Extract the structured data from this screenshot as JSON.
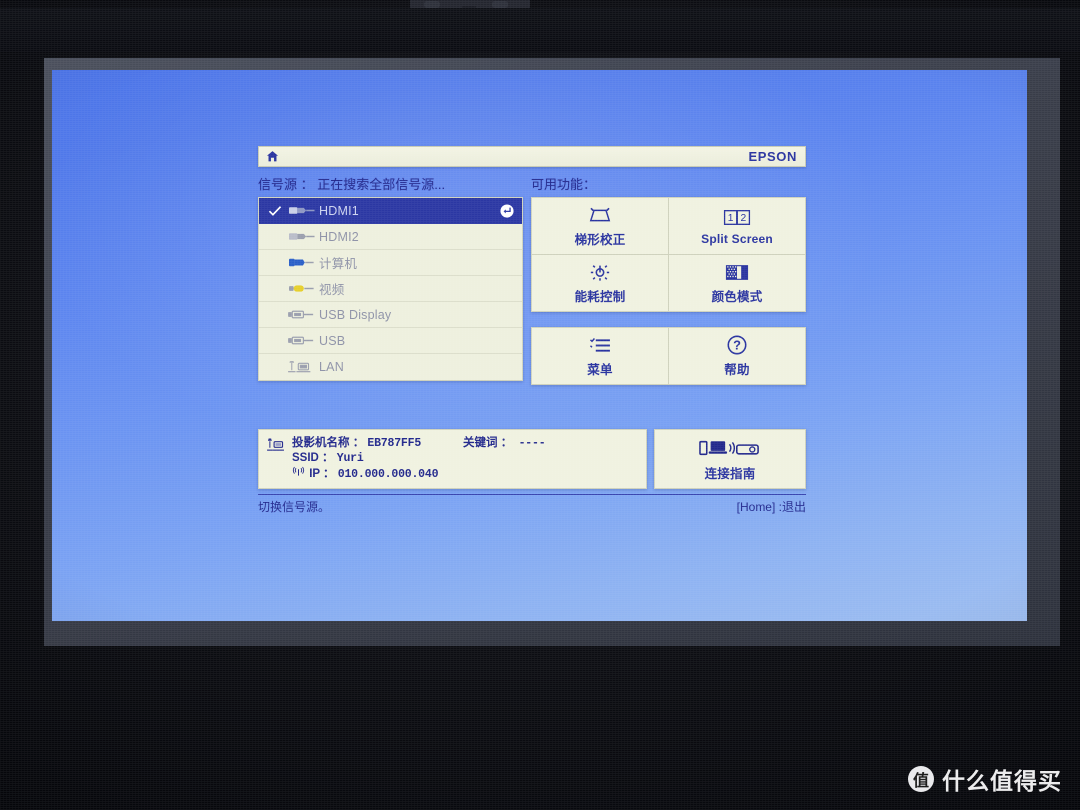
{
  "header": {
    "home_icon": "home-icon",
    "brand": "EPSON"
  },
  "labels": {
    "source_label": "信号源 ： 正在搜索全部信号源...",
    "functions_label": "可用功能："
  },
  "sources": [
    {
      "name": "HDMI1",
      "icon": "hdmi-connector-icon",
      "selected": true,
      "enter_icon": "enter-key-icon"
    },
    {
      "name": "HDMI2",
      "icon": "hdmi-connector-icon",
      "selected": false
    },
    {
      "name": "计算机",
      "icon": "vga-connector-icon",
      "selected": false
    },
    {
      "name": "视频",
      "icon": "composite-video-icon",
      "selected": false
    },
    {
      "name": "USB Display",
      "icon": "usb-connector-icon",
      "selected": false
    },
    {
      "name": "USB",
      "icon": "usb-connector-icon",
      "selected": false
    },
    {
      "name": "LAN",
      "icon": "lan-network-icon",
      "selected": false
    }
  ],
  "functions_top": [
    {
      "label": "梯形校正",
      "icon": "keystone-icon",
      "latin": false
    },
    {
      "label": "Split Screen",
      "icon": "split-screen-icon",
      "latin": true
    },
    {
      "label": "能耗控制",
      "icon": "power-consumption-icon",
      "latin": false
    },
    {
      "label": "颜色模式",
      "icon": "color-mode-icon",
      "latin": false
    }
  ],
  "functions_bottom": [
    {
      "label": "菜单",
      "icon": "menu-list-icon",
      "latin": false
    },
    {
      "label": "帮助",
      "icon": "help-question-icon",
      "latin": false
    }
  ],
  "info": {
    "lan_icon": "lan-network-icon",
    "projector_name_key": "投影机名称 ：",
    "projector_name_value": "EB787FF5",
    "keyword_key": "关键词 ：",
    "keyword_value": "----",
    "ssid_key": "SSID ：",
    "ssid_value": "Yuri",
    "ip_key": "IP ：",
    "ip_value": "010.000.000.040",
    "wifi_icon": "wifi-signal-icon"
  },
  "connect_guide": {
    "label": "连接指南",
    "icon": "connect-guide-icon"
  },
  "footer": {
    "hint": "切换信号源。",
    "exit": "[Home] :退出"
  },
  "watermark": {
    "logo_char": "值",
    "text": "什么值得买"
  },
  "colors": {
    "osd_panel": "#f0f2e0",
    "osd_blue": "#2a34a0",
    "selected_row": "#2b37a3",
    "projection_blue": "#5b84ef"
  }
}
